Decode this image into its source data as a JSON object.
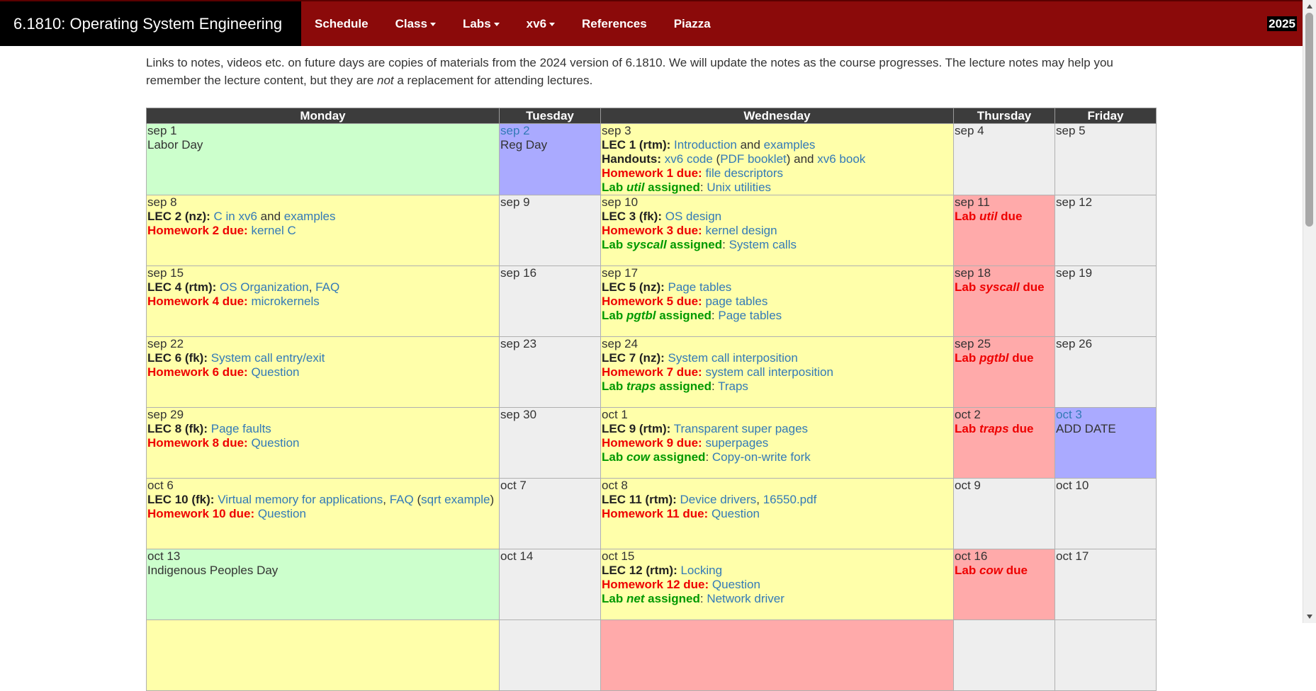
{
  "nav": {
    "brand": "6.1810: Operating System Engineering",
    "items": [
      {
        "label": "Schedule",
        "dropdown": false
      },
      {
        "label": "Class",
        "dropdown": true
      },
      {
        "label": "Labs",
        "dropdown": true
      },
      {
        "label": "xv6",
        "dropdown": true
      },
      {
        "label": "References",
        "dropdown": false
      },
      {
        "label": "Piazza",
        "dropdown": false
      }
    ],
    "year": "2025"
  },
  "intro": {
    "p1": "Links to notes, videos etc. on future days are copies of materials from the 2024 version of 6.1810. We will update the notes as the course progresses. The lecture notes may help you remember the lecture content, but they are ",
    "em": "not",
    "p2": " a replacement for attending lectures."
  },
  "days": [
    "Monday",
    "Tuesday",
    "Wednesday",
    "Thursday",
    "Friday"
  ],
  "weeks": [
    {
      "mon": {
        "date": "sep 1",
        "color": "green",
        "note": "Labor Day"
      },
      "tue": {
        "date": "sep 2",
        "color": "blue",
        "date_link": true,
        "note": "Reg Day"
      },
      "wed": {
        "date": "sep 3",
        "color": "yellow",
        "lec": {
          "label": "LEC 1 (rtm):",
          "links": [
            "Introduction",
            "examples"
          ],
          "sep": " and "
        },
        "handouts": {
          "label": "Handouts:",
          "l1": "xv6 code",
          "l2": "PDF booklet",
          "l3": "xv6 book"
        },
        "hw": {
          "label": "Homework 1 due:",
          "link": "file descriptors"
        },
        "lab": {
          "pre": "Lab ",
          "name": "util",
          "post": " assigned",
          "link": "Unix utilities"
        }
      },
      "thu": {
        "date": "sep 4",
        "color": "gray"
      },
      "fri": {
        "date": "sep 5",
        "color": "gray"
      }
    },
    {
      "mon": {
        "date": "sep 8",
        "color": "yellow",
        "lec": {
          "label": "LEC 2 (nz):",
          "links": [
            "C in xv6",
            "examples"
          ],
          "sep": " and "
        },
        "hw": {
          "label": "Homework 2 due:",
          "link": "kernel C"
        }
      },
      "tue": {
        "date": "sep 9",
        "color": "gray"
      },
      "wed": {
        "date": "sep 10",
        "color": "yellow",
        "lec": {
          "label": "LEC 3 (fk):",
          "links": [
            "OS design"
          ]
        },
        "hw": {
          "label": "Homework 3 due:",
          "link": "kernel design"
        },
        "lab": {
          "pre": "Lab ",
          "name": "syscall",
          "post": " assigned",
          "link": "System calls"
        }
      },
      "thu": {
        "date": "sep 11",
        "color": "red",
        "due": {
          "pre": "Lab ",
          "name": "util",
          "post": " due"
        }
      },
      "fri": {
        "date": "sep 12",
        "color": "gray"
      }
    },
    {
      "mon": {
        "date": "sep 15",
        "color": "yellow",
        "lec": {
          "label": "LEC 4 (rtm):",
          "links": [
            "OS Organization",
            "FAQ"
          ],
          "sep": ", "
        },
        "hw": {
          "label": "Homework 4 due:",
          "link": "microkernels"
        }
      },
      "tue": {
        "date": "sep 16",
        "color": "gray"
      },
      "wed": {
        "date": "sep 17",
        "color": "yellow",
        "lec": {
          "label": "LEC 5 (nz):",
          "links": [
            "Page tables"
          ]
        },
        "hw": {
          "label": "Homework 5 due:",
          "link": "page tables"
        },
        "lab": {
          "pre": "Lab ",
          "name": "pgtbl",
          "post": " assigned",
          "link": "Page tables"
        }
      },
      "thu": {
        "date": "sep 18",
        "color": "red",
        "due": {
          "pre": "Lab ",
          "name": "syscall",
          "post": " due"
        }
      },
      "fri": {
        "date": "sep 19",
        "color": "gray"
      }
    },
    {
      "mon": {
        "date": "sep 22",
        "color": "yellow",
        "lec": {
          "label": "LEC 6 (fk):",
          "links": [
            "System call entry/exit"
          ]
        },
        "hw": {
          "label": "Homework 6 due:",
          "link": "Question"
        }
      },
      "tue": {
        "date": "sep 23",
        "color": "gray"
      },
      "wed": {
        "date": "sep 24",
        "color": "yellow",
        "lec": {
          "label": "LEC 7 (nz):",
          "links": [
            "System call interposition"
          ]
        },
        "hw": {
          "label": "Homework 7 due:",
          "link": "system call interposition"
        },
        "lab": {
          "pre": "Lab ",
          "name": "traps",
          "post": " assigned",
          "link": "Traps"
        }
      },
      "thu": {
        "date": "sep 25",
        "color": "red",
        "due": {
          "pre": "Lab ",
          "name": "pgtbl",
          "post": " due"
        }
      },
      "fri": {
        "date": "sep 26",
        "color": "gray"
      }
    },
    {
      "mon": {
        "date": "sep 29",
        "color": "yellow",
        "lec": {
          "label": "LEC 8 (fk):",
          "links": [
            "Page faults"
          ]
        },
        "hw": {
          "label": "Homework 8 due:",
          "link": "Question"
        }
      },
      "tue": {
        "date": "sep 30",
        "color": "gray"
      },
      "wed": {
        "date": "oct 1",
        "color": "yellow",
        "lec": {
          "label": "LEC 9 (rtm):",
          "links": [
            "Transparent super pages"
          ]
        },
        "hw": {
          "label": "Homework 9 due:",
          "link": "superpages"
        },
        "lab": {
          "pre": "Lab ",
          "name": "cow",
          "post": " assigned",
          "link": "Copy-on-write fork"
        }
      },
      "thu": {
        "date": "oct 2",
        "color": "red",
        "due": {
          "pre": "Lab ",
          "name": "traps",
          "post": " due"
        }
      },
      "fri": {
        "date": "oct 3",
        "color": "blue",
        "date_link": true,
        "note": "ADD DATE"
      }
    },
    {
      "mon": {
        "date": "oct 6",
        "color": "yellow",
        "lec10": {
          "label": "LEC 10 (fk):",
          "l1": "Virtual memory for applications",
          "l2": "FAQ",
          "l3": "sqrt example"
        },
        "hw": {
          "label": "Homework 10 due:",
          "link": "Question"
        }
      },
      "tue": {
        "date": "oct 7",
        "color": "gray"
      },
      "wed": {
        "date": "oct 8",
        "color": "yellow",
        "lec": {
          "label": "LEC 11 (rtm):",
          "links": [
            "Device drivers",
            "16550.pdf"
          ],
          "sep": ", "
        },
        "hw": {
          "label": "Homework 11 due:",
          "link": "Question"
        }
      },
      "thu": {
        "date": "oct 9",
        "color": "gray"
      },
      "fri": {
        "date": "oct 10",
        "color": "gray"
      }
    },
    {
      "mon": {
        "date": "oct 13",
        "color": "green",
        "note": "Indigenous Peoples Day"
      },
      "tue": {
        "date": "oct 14",
        "color": "gray"
      },
      "wed": {
        "date": "oct 15",
        "color": "yellow",
        "lec": {
          "label": "LEC 12 (rtm):",
          "links": [
            "Locking"
          ]
        },
        "hw": {
          "label": "Homework 12 due:",
          "link": "Question"
        },
        "lab": {
          "pre": "Lab ",
          "name": "net",
          "post": " assigned",
          "link": "Network driver"
        }
      },
      "thu": {
        "date": "oct 16",
        "color": "red",
        "due": {
          "pre": "Lab ",
          "name": "cow",
          "post": " due"
        }
      },
      "fri": {
        "date": "oct 17",
        "color": "gray"
      }
    }
  ],
  "partial_row_colors": [
    "yellow",
    "gray",
    "pink",
    "gray",
    "gray"
  ]
}
